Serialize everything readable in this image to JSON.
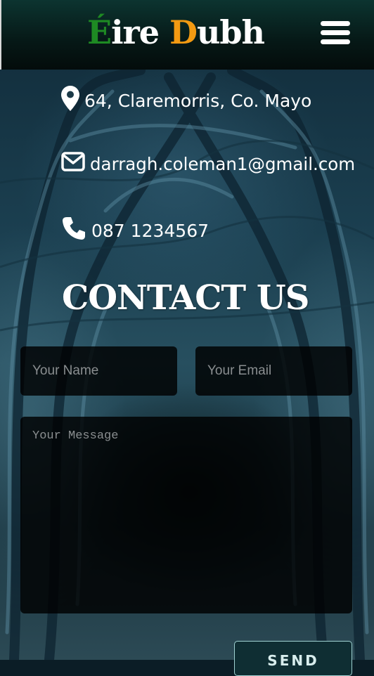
{
  "header": {
    "logo_part1": "É",
    "logo_part2": "ire ",
    "logo_part3": "D",
    "logo_part4": "ubh",
    "menu_icon": "hamburger-menu-icon"
  },
  "contact_info": {
    "address": {
      "icon": "map-marker-icon",
      "text": "64, Claremorris, Co. Mayo"
    },
    "email": {
      "icon": "envelope-icon",
      "text": "darragh.coleman1@gmail.com"
    },
    "phone": {
      "icon": "phone-icon",
      "text": "087 1234567"
    }
  },
  "contact_title": "CONTACT US",
  "form": {
    "name_placeholder": "Your Name",
    "email_placeholder": "Your Email",
    "message_placeholder": "Your Message",
    "send_label": "SEND"
  },
  "colors": {
    "logo_green": "#1e8a23",
    "logo_orange": "#f39a12",
    "header_bg": "#061816",
    "field_bg": "#000000"
  }
}
